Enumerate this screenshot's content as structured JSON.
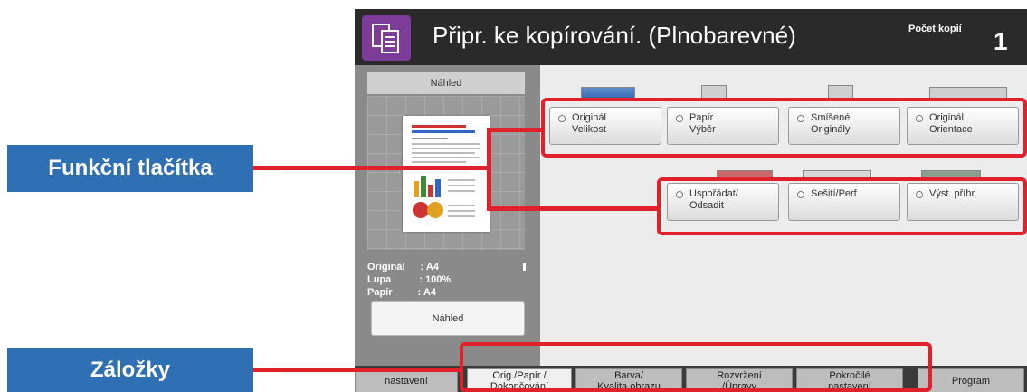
{
  "callouts": {
    "function_buttons": "Funkční tlačítka",
    "tabs": "Záložky"
  },
  "header": {
    "title": "Připr. ke kopírování. (Plnobarevné)",
    "copies_label": "Počet kopií",
    "copies_value": "1"
  },
  "preview": {
    "header": "Náhled",
    "original_label": "Originál",
    "original_value": ": A4",
    "zoom_label": "Lupa",
    "zoom_value": ": 100%",
    "paper_label": "Papír",
    "paper_value": ": A4",
    "button": "Náhled"
  },
  "functions": {
    "row1": [
      {
        "line1": "Originál",
        "line2": "Velikost"
      },
      {
        "line1": "Papír",
        "line2": "Výběr"
      },
      {
        "line1": "Smíšené",
        "line2": "Originály"
      },
      {
        "line1": "Originál",
        "line2": "Orientace"
      }
    ],
    "row2": [
      {
        "line1": "Uspořádat/",
        "line2": "Odsadit"
      },
      {
        "line1": "Sešití/Perf",
        "line2": ""
      },
      {
        "line1": "Výst. příhr.",
        "line2": ""
      }
    ]
  },
  "tabs": [
    {
      "line1": "nastavení",
      "line2": ""
    },
    {
      "line1": "Orig./Papír /",
      "line2": "Dokončování"
    },
    {
      "line1": "Barva/",
      "line2": "Kvalita obrazu"
    },
    {
      "line1": "Rozvržení",
      "line2": "/Úpravy"
    },
    {
      "line1": "Pokročilé",
      "line2": "nastavení"
    },
    {
      "line1": "Program",
      "line2": ""
    }
  ],
  "colors": {
    "callout_bg": "#2f6fb4",
    "highlight": "#e0202a",
    "app_icon": "#7d3c98"
  }
}
